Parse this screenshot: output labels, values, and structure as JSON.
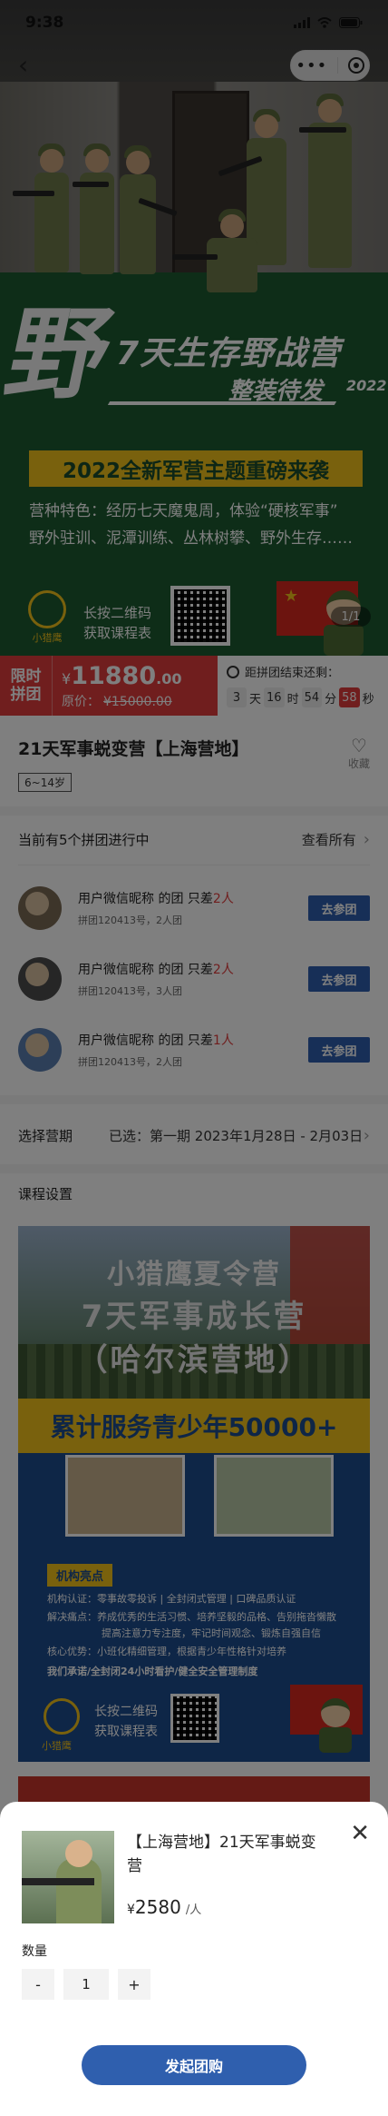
{
  "status_bar": {
    "time": "9:38"
  },
  "hero": {
    "big_char": "野",
    "title": "7天生存野战营",
    "subtitle": "整装待发",
    "year": "2022",
    "banner": "2022全新军营主题重磅来袭",
    "features": [
      "营种特色：经历七天魔鬼周，体验“硬核军事”",
      "野外驻训、泥潭训练、丛林树攀、野外生存……"
    ],
    "logo_text": "小猎鹰",
    "qr_lines": [
      "长按二维码",
      "获取课程表"
    ],
    "page_indicator": "1/1"
  },
  "price_bar": {
    "tag_line1": "限时",
    "tag_line2": "拼团",
    "currency": "¥",
    "price_int": "11880",
    "price_dec": ".00",
    "original_label": "原价：",
    "original_price": "¥15000.00",
    "countdown_label": "距拼团结束还剩：",
    "countdown": {
      "days": "3",
      "days_unit": "天",
      "hours": "16",
      "hours_unit": "时",
      "minutes": "54",
      "minutes_unit": "分",
      "seconds": "58",
      "seconds_unit": "秒"
    }
  },
  "product": {
    "title": "21天军事蜕变营【上海营地】",
    "age": "6~14岁",
    "fav_label": "收藏"
  },
  "groups": {
    "header": "当前有5个拼团进行中",
    "view_all": "查看所有",
    "items": [
      {
        "name": "用户微信昵称 的团 只差",
        "need": "2人",
        "info": "拼团120413号，2人团",
        "button": "去参团"
      },
      {
        "name": "用户微信昵称 的团 只差",
        "need": "2人",
        "info": "拼团120413号，3人团",
        "button": "去参团"
      },
      {
        "name": "用户微信昵称 的团 只差",
        "need": "1人",
        "info": "拼团120413号，2人团",
        "button": "去参团"
      }
    ]
  },
  "period": {
    "label": "选择营期",
    "selected": "已选：第一期 2023年1月28日 - 2月03日"
  },
  "course": {
    "label": "课程设置",
    "poster": {
      "line1": "小猎鹰夏令营",
      "line2": "7天军事成长营",
      "line3": "（哈尔滨营地）",
      "banner": "累计服务青少年50000+",
      "tag": "机构亮点",
      "lines": [
        "机构认证：零事故零投诉 | 全封闭式管理 | 口碑品质认证",
        "解决痛点：养成优秀的生活习惯、培养坚毅的品格、告别拖沓懒散",
        "提高注意力专注度，牢记时间观念、锻炼自强自信",
        "核心优势：小班化精细管理，根据青少年性格针对培养",
        "我们承诺/全封闭24小时看护/健全安全管理制度"
      ],
      "logo_text": "小猎鹰",
      "qr_lines": [
        "长按二维码",
        "获取课程表"
      ]
    }
  },
  "sheet": {
    "title": "【上海营地】21天军事蜕变营",
    "currency": "¥",
    "price": "2580",
    "unit": "/人",
    "qty_label": "数量",
    "minus": "-",
    "qty": "1",
    "plus": "+",
    "submit": "发起团购"
  },
  "colors": {
    "brand_blue": "#2f5fae",
    "price_red": "#e03c3c",
    "poster_green": "#1c5a31",
    "accent_yellow": "#f2c21b"
  }
}
